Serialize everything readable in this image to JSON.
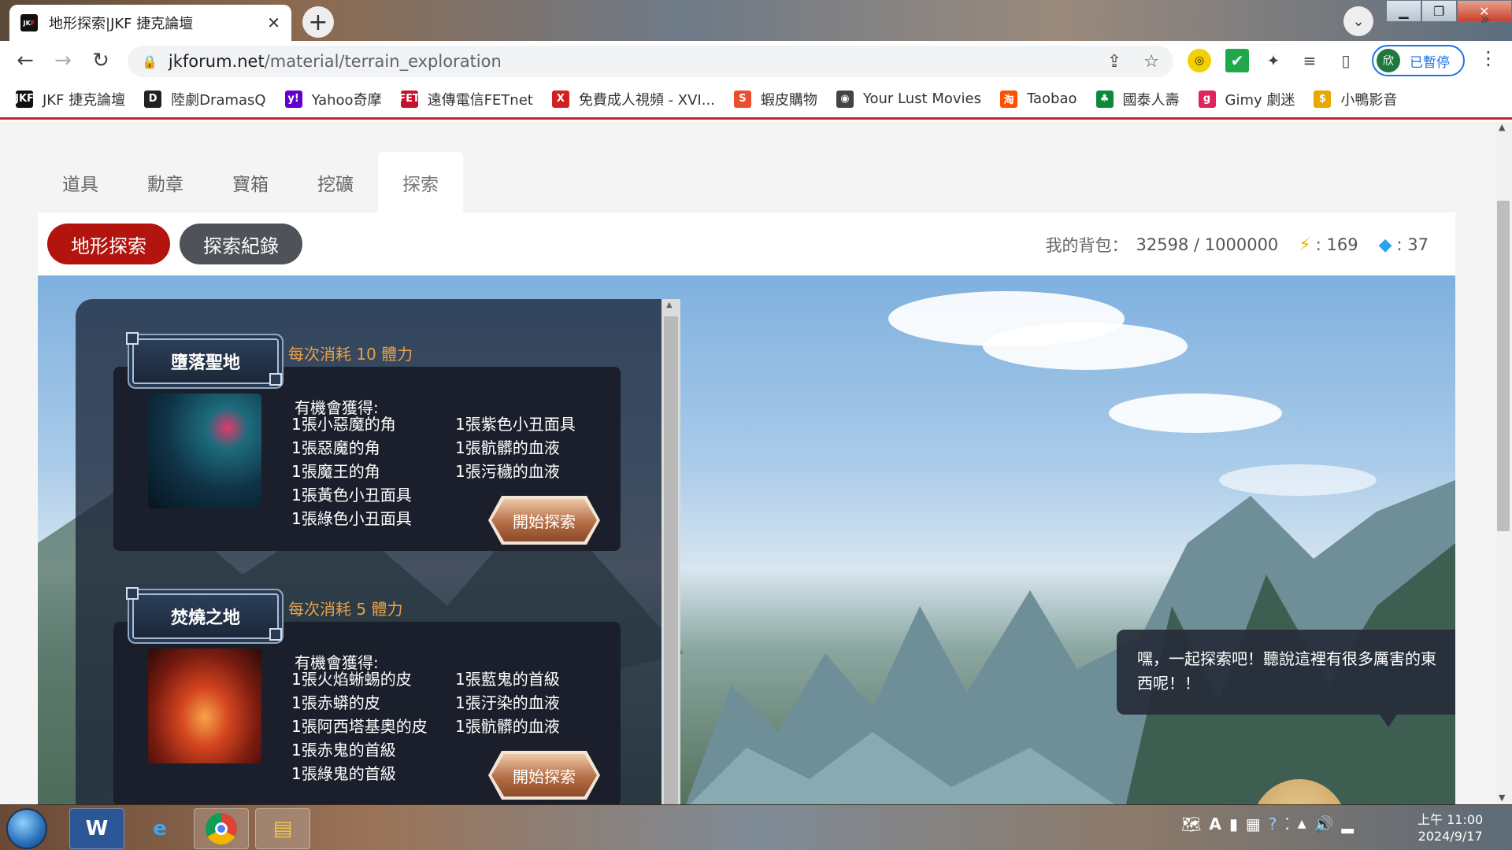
{
  "browser": {
    "tab_title": "地形探索|JKF 捷克論壇",
    "tab_favicon": "JKF",
    "tab_close": "✕",
    "url_host": "jkforum.net",
    "url_path": "/material/terrain_exploration",
    "profile_initial": "欣",
    "profile_label": "已暫停"
  },
  "bookmarks": [
    {
      "label": "JKF 捷克論壇",
      "icon": "JKF",
      "color": "#111111"
    },
    {
      "label": "陸劇DramasQ",
      "icon": "D",
      "color": "#222222"
    },
    {
      "label": "Yahoo奇摩",
      "icon": "y!",
      "color": "#6001d2"
    },
    {
      "label": "遠傳電信FETnet",
      "icon": "FET",
      "color": "#c8102e"
    },
    {
      "label": "免費成人視頻 - XVI...",
      "icon": "X",
      "color": "#d21f1f"
    },
    {
      "label": "蝦皮購物",
      "icon": "S",
      "color": "#ee4d2d"
    },
    {
      "label": "Your Lust Movies",
      "icon": "◉",
      "color": "#444444"
    },
    {
      "label": "Taobao",
      "icon": "淘",
      "color": "#ff5000"
    },
    {
      "label": "國泰人壽",
      "icon": "♣",
      "color": "#0a8a3a"
    },
    {
      "label": "Gimy 劇迷",
      "icon": "g",
      "color": "#e0245e"
    },
    {
      "label": "小鴨影音",
      "icon": "$",
      "color": "#e8a800"
    }
  ],
  "bookmarks_more": "»",
  "category_tabs": [
    "道具",
    "勳章",
    "寶箱",
    "挖礦",
    "探索"
  ],
  "active_category": "探索",
  "subnav": {
    "explore": "地形探索",
    "log": "探索紀錄"
  },
  "stats": {
    "bag_label": "我的背包：",
    "bag_value": "32598 / 1000000",
    "energy_value": ": 169",
    "gem_value": ": 37"
  },
  "terrains": [
    {
      "name": "墮落聖地",
      "cost": "每次消耗 10 體力",
      "gain_header": "有機會獲得:",
      "items_left": [
        "1張小惡魔的角",
        "1張惡魔的角",
        "1張魔王的角",
        "1張黃色小丑面具",
        "1張綠色小丑面具"
      ],
      "items_right": [
        "1張紫色小丑面具",
        "1張骯髒的血液",
        "1張污穢的血液"
      ],
      "button": "開始探索"
    },
    {
      "name": "焚燒之地",
      "cost": "每次消耗 5 體力",
      "gain_header": "有機會獲得:",
      "items_left": [
        "1張火焰蜥蜴的皮",
        "1張赤蟒的皮",
        "1張阿西塔基奧的皮",
        "1張赤鬼的首級",
        "1張綠鬼的首級"
      ],
      "items_right": [
        "1張藍鬼的首級",
        "1張汙染的血液",
        "1張骯髒的血液"
      ],
      "button": "開始探索"
    }
  ],
  "speech": "嘿，一起探索吧！聽說這裡有很多厲害的東西呢！！",
  "clock": {
    "time": "上午 11:00",
    "date": "2024/9/17"
  },
  "colors": {
    "accent_red": "#b3140e",
    "cost_orange": "#e6a14a"
  }
}
